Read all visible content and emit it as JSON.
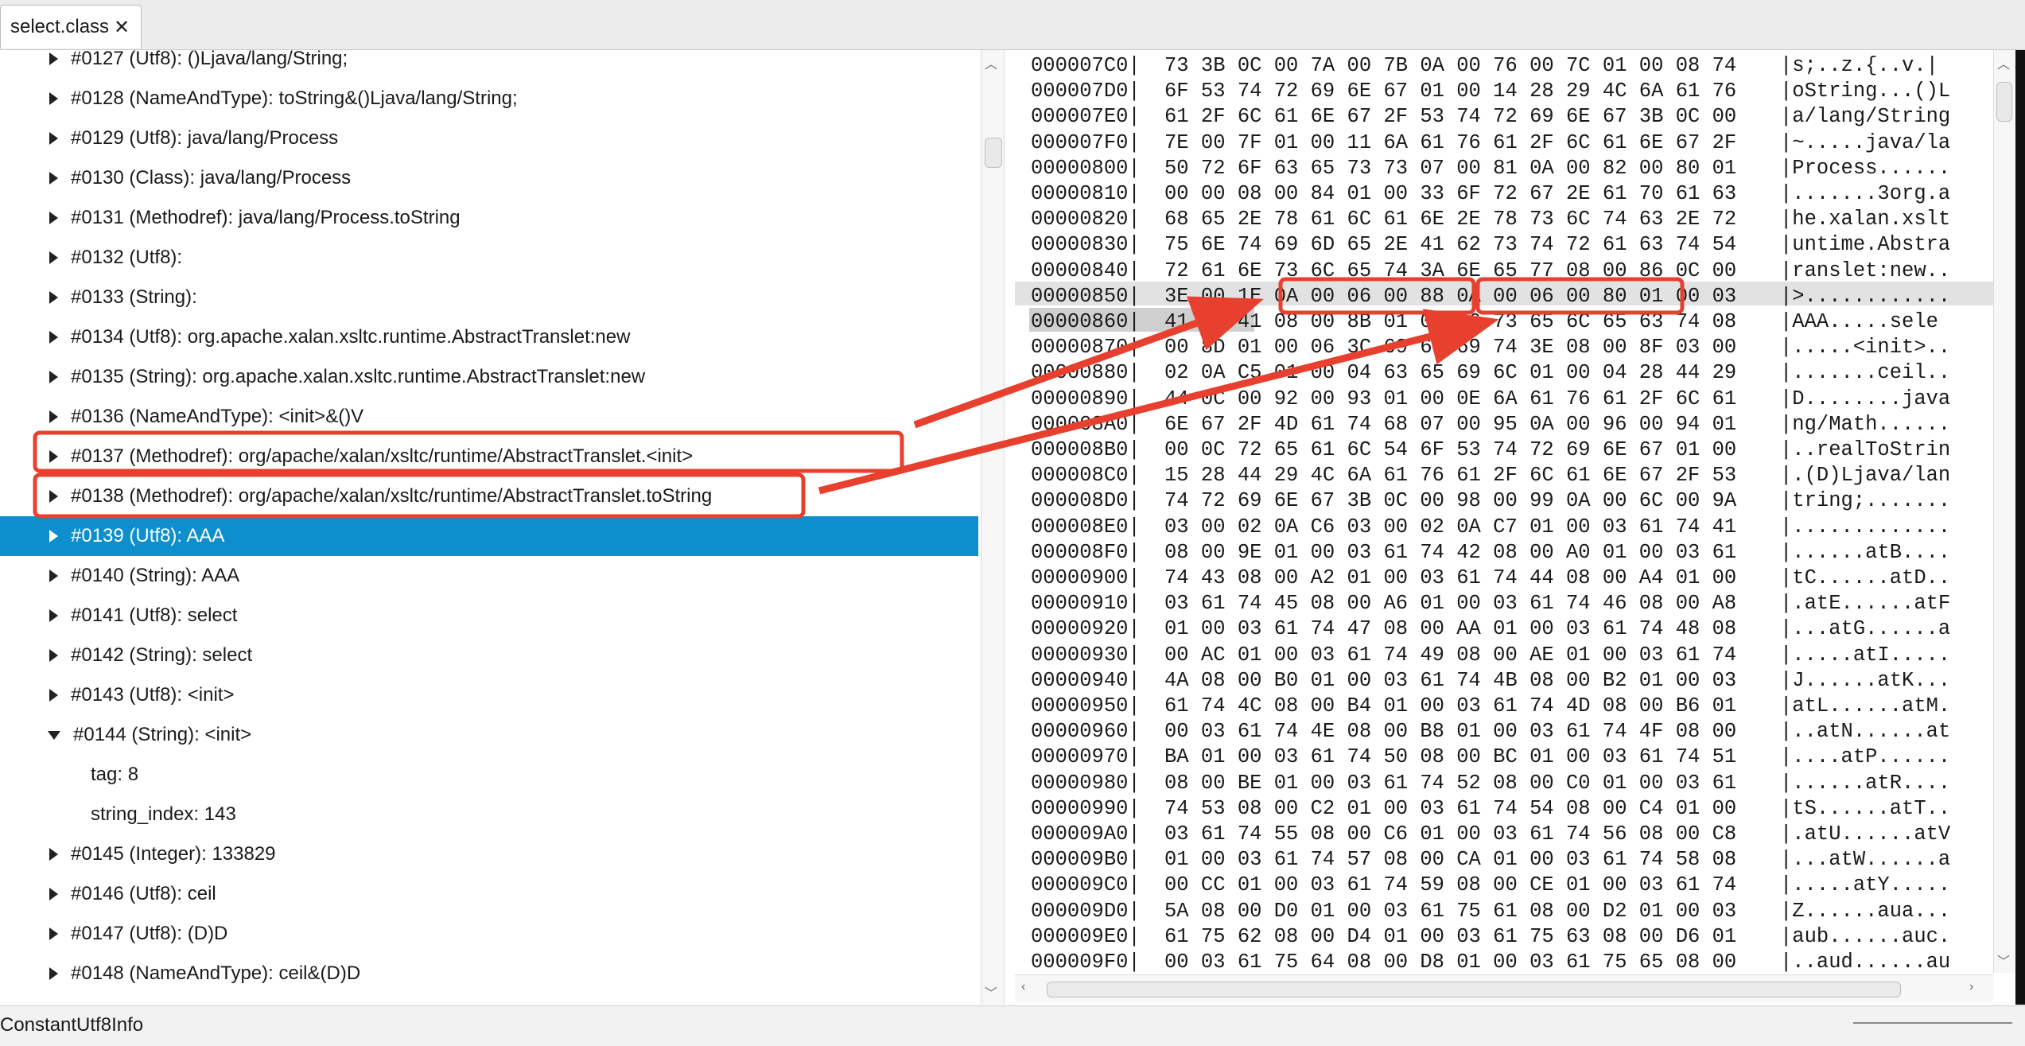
{
  "tab": {
    "label": "select.class",
    "close_glyph": "✕"
  },
  "tree_rows": [
    {
      "label": "#0127 (Utf8): ()Ljava/lang/String;",
      "kind": "collapsed"
    },
    {
      "label": "#0128 (NameAndType): toString&()Ljava/lang/String;",
      "kind": "collapsed"
    },
    {
      "label": "#0129 (Utf8): java/lang/Process",
      "kind": "collapsed"
    },
    {
      "label": "#0130 (Class): java/lang/Process",
      "kind": "collapsed"
    },
    {
      "label": "#0131 (Methodref): java/lang/Process.toString",
      "kind": "collapsed"
    },
    {
      "label": "#0132 (Utf8):",
      "kind": "collapsed"
    },
    {
      "label": "#0133 (String):",
      "kind": "collapsed"
    },
    {
      "label": "#0134 (Utf8): org.apache.xalan.xsltc.runtime.AbstractTranslet:new",
      "kind": "collapsed"
    },
    {
      "label": "#0135 (String): org.apache.xalan.xsltc.runtime.AbstractTranslet:new",
      "kind": "collapsed"
    },
    {
      "label": "#0136 (NameAndType): <init>&()V",
      "kind": "collapsed"
    },
    {
      "label": "#0137 (Methodref): org/apache/xalan/xsltc/runtime/AbstractTranslet.<init>",
      "kind": "collapsed",
      "boxed": true
    },
    {
      "label": "#0138 (Methodref): org/apache/xalan/xsltc/runtime/AbstractTranslet.toString",
      "kind": "collapsed",
      "boxed": true
    },
    {
      "label": "#0139 (Utf8): AAA",
      "kind": "collapsed",
      "selected": true
    },
    {
      "label": "#0140 (String): AAA",
      "kind": "collapsed"
    },
    {
      "label": "#0141 (Utf8): select",
      "kind": "collapsed"
    },
    {
      "label": "#0142 (String): select",
      "kind": "collapsed"
    },
    {
      "label": "#0143 (Utf8): <init>",
      "kind": "collapsed"
    },
    {
      "label": "#0144 (String): <init>",
      "kind": "expanded"
    },
    {
      "label": "tag: 8",
      "kind": "child"
    },
    {
      "label": "string_index: 143",
      "kind": "child"
    },
    {
      "label": "#0145 (Integer): 133829",
      "kind": "collapsed"
    },
    {
      "label": "#0146 (Utf8): ceil",
      "kind": "collapsed"
    },
    {
      "label": "#0147 (Utf8): (D)D",
      "kind": "collapsed"
    },
    {
      "label": "#0148 (NameAndType): ceil&(D)D",
      "kind": "collapsed"
    }
  ],
  "hex_rows": [
    {
      "off": "000007C0|",
      "hex": "73 3B 0C 00 7A 00 7B 0A 00 76 00 7C 01 00 08 74",
      "ascii": "|s;..z.{..v.|"
    },
    {
      "off": "000007D0|",
      "hex": "6F 53 74 72 69 6E 67 01 00 14 28 29 4C 6A 61 76",
      "ascii": "|oString...()L"
    },
    {
      "off": "000007E0|",
      "hex": "61 2F 6C 61 6E 67 2F 53 74 72 69 6E 67 3B 0C 00",
      "ascii": "|a/lang/String"
    },
    {
      "off": "000007F0|",
      "hex": "7E 00 7F 01 00 11 6A 61 76 61 2F 6C 61 6E 67 2F",
      "ascii": "|~.....java/la"
    },
    {
      "off": "00000800|",
      "hex": "50 72 6F 63 65 73 73 07 00 81 0A 00 82 00 80 01",
      "ascii": "|Process......"
    },
    {
      "off": "00000810|",
      "hex": "00 00 08 00 84 01 00 33 6F 72 67 2E 61 70 61 63",
      "ascii": "|.......3org.a"
    },
    {
      "off": "00000820|",
      "hex": "68 65 2E 78 61 6C 61 6E 2E 78 73 6C 74 63 2E 72",
      "ascii": "|he.xalan.xslt"
    },
    {
      "off": "00000830|",
      "hex": "75 6E 74 69 6D 65 2E 41 62 73 74 72 61 63 74 54",
      "ascii": "|untime.Abstra"
    },
    {
      "off": "00000840|",
      "hex": "72 61 6E 73 6C 65 74 3A 6E 65 77 08 00 86 0C 00",
      "ascii": "|ranslet:new.."
    },
    {
      "off": "00000850|",
      "hex": "3E 00 1E 0A 00 06 00 88 0A 00 06 00 80 01 00 03",
      "ascii": "|>............"
    },
    {
      "off": "00000860|",
      "hex": "41 41 41 08 00 8B 01 00 06 73 65 6C 65 63 74 08",
      "ascii": "|AAA.....sele"
    },
    {
      "off": "00000870|",
      "hex": "00 8D 01 00 06 3C 69 6E 69 74 3E 08 00 8F 03 00",
      "ascii": "|.....<init>.."
    },
    {
      "off": "00000880|",
      "hex": "02 0A C5 01 00 04 63 65 69 6C 01 00 04 28 44 29",
      "ascii": "|.......ceil.."
    },
    {
      "off": "00000890|",
      "hex": "44 0C 00 92 00 93 01 00 0E 6A 61 76 61 2F 6C 61",
      "ascii": "|D........java"
    },
    {
      "off": "000008A0|",
      "hex": "6E 67 2F 4D 61 74 68 07 00 95 0A 00 96 00 94 01",
      "ascii": "|ng/Math......"
    },
    {
      "off": "000008B0|",
      "hex": "00 0C 72 65 61 6C 54 6F 53 74 72 69 6E 67 01 00",
      "ascii": "|..realToStrin"
    },
    {
      "off": "000008C0|",
      "hex": "15 28 44 29 4C 6A 61 76 61 2F 6C 61 6E 67 2F 53",
      "ascii": "|.(D)Ljava/lan"
    },
    {
      "off": "000008D0|",
      "hex": "74 72 69 6E 67 3B 0C 00 98 00 99 0A 00 6C 00 9A",
      "ascii": "|tring;......."
    },
    {
      "off": "000008E0|",
      "hex": "03 00 02 0A C6 03 00 02 0A C7 01 00 03 61 74 41",
      "ascii": "|............."
    },
    {
      "off": "000008F0|",
      "hex": "08 00 9E 01 00 03 61 74 42 08 00 A0 01 00 03 61",
      "ascii": "|......atB...."
    },
    {
      "off": "00000900|",
      "hex": "74 43 08 00 A2 01 00 03 61 74 44 08 00 A4 01 00",
      "ascii": "|tC......atD.."
    },
    {
      "off": "00000910|",
      "hex": "03 61 74 45 08 00 A6 01 00 03 61 74 46 08 00 A8",
      "ascii": "|.atE......atF"
    },
    {
      "off": "00000920|",
      "hex": "01 00 03 61 74 47 08 00 AA 01 00 03 61 74 48 08",
      "ascii": "|...atG......a"
    },
    {
      "off": "00000930|",
      "hex": "00 AC 01 00 03 61 74 49 08 00 AE 01 00 03 61 74",
      "ascii": "|.....atI....."
    },
    {
      "off": "00000940|",
      "hex": "4A 08 00 B0 01 00 03 61 74 4B 08 00 B2 01 00 03",
      "ascii": "|J......atK..."
    },
    {
      "off": "00000950|",
      "hex": "61 74 4C 08 00 B4 01 00 03 61 74 4D 08 00 B6 01",
      "ascii": "|atL......atM."
    },
    {
      "off": "00000960|",
      "hex": "00 03 61 74 4E 08 00 B8 01 00 03 61 74 4F 08 00",
      "ascii": "|..atN......at"
    },
    {
      "off": "00000970|",
      "hex": "BA 01 00 03 61 74 50 08 00 BC 01 00 03 61 74 51",
      "ascii": "|....atP......"
    },
    {
      "off": "00000980|",
      "hex": "08 00 BE 01 00 03 61 74 52 08 00 C0 01 00 03 61",
      "ascii": "|......atR...."
    },
    {
      "off": "00000990|",
      "hex": "74 53 08 00 C2 01 00 03 61 74 54 08 00 C4 01 00",
      "ascii": "|tS......atT.."
    },
    {
      "off": "000009A0|",
      "hex": "03 61 74 55 08 00 C6 01 00 03 61 74 56 08 00 C8",
      "ascii": "|.atU......atV"
    },
    {
      "off": "000009B0|",
      "hex": "01 00 03 61 74 57 08 00 CA 01 00 03 61 74 58 08",
      "ascii": "|...atW......a"
    },
    {
      "off": "000009C0|",
      "hex": "00 CC 01 00 03 61 74 59 08 00 CE 01 00 03 61 74",
      "ascii": "|.....atY....."
    },
    {
      "off": "000009D0|",
      "hex": "5A 08 00 D0 01 00 03 61 75 61 08 00 D2 01 00 03",
      "ascii": "|Z......aua..."
    },
    {
      "off": "000009E0|",
      "hex": "61 75 62 08 00 D4 01 00 03 61 75 63 08 00 D6 01",
      "ascii": "|aub......auc."
    },
    {
      "off": "000009F0|",
      "hex": "00 03 61 75 64 08 00 D8 01 00 03 61 75 65 08 00",
      "ascii": "|..aud......au"
    }
  ],
  "status": {
    "text": "ConstantUtf8Info"
  },
  "colors": {
    "selection": "#0d8fce",
    "annotation_red": "#e8402f",
    "hex_highlight": "#cfcfcf"
  }
}
